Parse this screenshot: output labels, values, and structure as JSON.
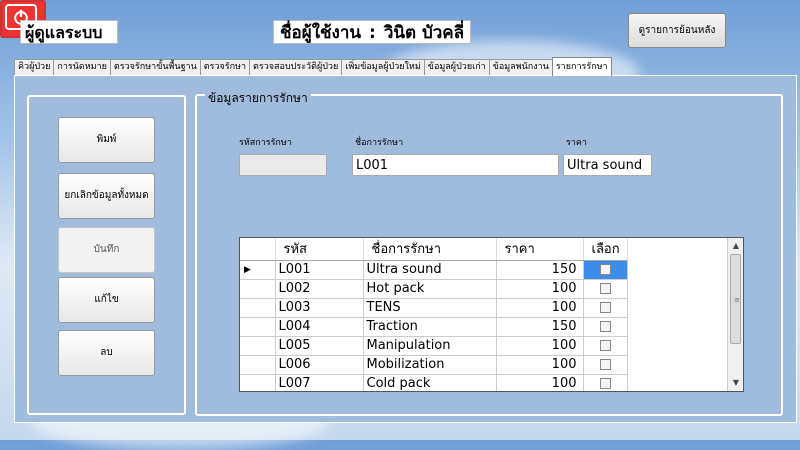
{
  "header": {
    "admin_label": "ผู้ดูแลระบบ",
    "user_label": "ชื่อผู้ใช้งาน",
    "user_sep": ":",
    "user_name": "วินิต บัวคลี่",
    "history_button": "ดูรายการย้อนหลัง",
    "power_icon": "power-icon"
  },
  "tabs": [
    {
      "label": "คิวผู้ป่วย",
      "active": false
    },
    {
      "label": "การนัดหมาย",
      "active": false
    },
    {
      "label": "ตรวจรักษาขั้นพื้นฐาน",
      "active": false
    },
    {
      "label": "ตรวจรักษา",
      "active": false
    },
    {
      "label": "ตรวจสอบประวัติผู้ป่วย",
      "active": false
    },
    {
      "label": "เพิ่มข้อมูลผู้ป่วยใหม่",
      "active": false
    },
    {
      "label": "ข้อมูลผู้ป่วยเก่า",
      "active": false
    },
    {
      "label": "ข้อมูลพนักงาน",
      "active": false
    },
    {
      "label": "รายการรักษา",
      "active": true
    }
  ],
  "side_buttons": {
    "print": "พิมพ์",
    "cancel_all": "ยกเลิกข้อมูลทั้งหมด",
    "save": "บันทึก",
    "edit": "แก้ไข",
    "delete": "ลบ"
  },
  "info": {
    "title": "ข้อมูลรายการรักษา",
    "code_label": "รหัสการรักษา",
    "code_value": "",
    "name_label": "ชื่อการรักษา",
    "name_value": "L001",
    "price_label": "ราคา",
    "price_value": "Ultra sound"
  },
  "grid": {
    "columns": [
      "รหัส",
      "ชื่อการรักษา",
      "ราคา",
      "เลือก"
    ],
    "current_row_marker": "▶",
    "rows": [
      {
        "code": "L001",
        "name": "Ultra sound",
        "price": "150"
      },
      {
        "code": "L002",
        "name": "Hot pack",
        "price": "100"
      },
      {
        "code": "L003",
        "name": "TENS",
        "price": "100"
      },
      {
        "code": "L004",
        "name": "Traction",
        "price": "150"
      },
      {
        "code": "L005",
        "name": "Manipulation",
        "price": "100"
      },
      {
        "code": "L006",
        "name": "Mobilization",
        "price": "100"
      },
      {
        "code": "L007",
        "name": "Cold pack",
        "price": "100"
      }
    ]
  }
}
